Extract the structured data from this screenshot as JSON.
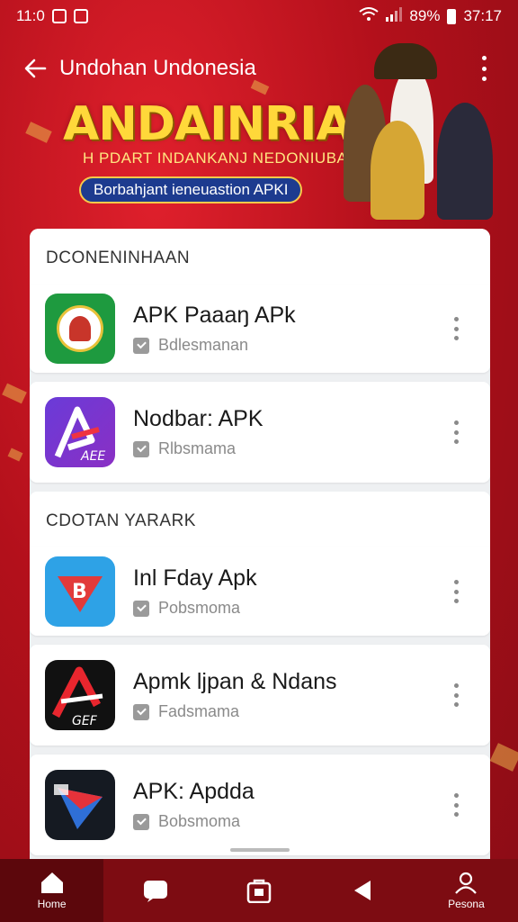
{
  "status_bar": {
    "left_text": "11:0",
    "battery": "89%",
    "time": "37:17"
  },
  "header": {
    "title": "Undohan Undonesia"
  },
  "banner": {
    "title": "ANDAINRIA",
    "subtitle": "H PDART INDANKANJ NEDONIUBAK",
    "pill": "Borbahjant ieneuastion APKI"
  },
  "sections": [
    {
      "header": "DCONENINHAAN",
      "items": [
        {
          "title": "APK Paaaŋ APk",
          "meta": "Bdlesmanan",
          "icon": "green-emblem-icon"
        },
        {
          "title": "Nodbar: APK",
          "meta": "Rlbsmama",
          "icon": "purple-a-logo-icon"
        }
      ]
    },
    {
      "header": "CDOTAN YARARK",
      "items": [
        {
          "title": "Inl Fday Apk",
          "meta": "Pobsmoma",
          "icon": "blue-b-logo-icon"
        },
        {
          "title": "Apmk ljpan & Ndans",
          "meta": "Fadsmama",
          "icon": "black-a-logo-icon"
        },
        {
          "title": "APK: Apdda",
          "meta": "Bobsmoma",
          "icon": "dark-triangle-logo-icon"
        }
      ]
    }
  ],
  "bottom_nav": [
    {
      "label": "Home",
      "icon": "home-icon"
    },
    {
      "label": "",
      "icon": "chat-icon"
    },
    {
      "label": "",
      "icon": "bag-icon"
    },
    {
      "label": "",
      "icon": "back-triangle-icon"
    },
    {
      "label": "Pesona",
      "icon": "profile-icon"
    }
  ]
}
